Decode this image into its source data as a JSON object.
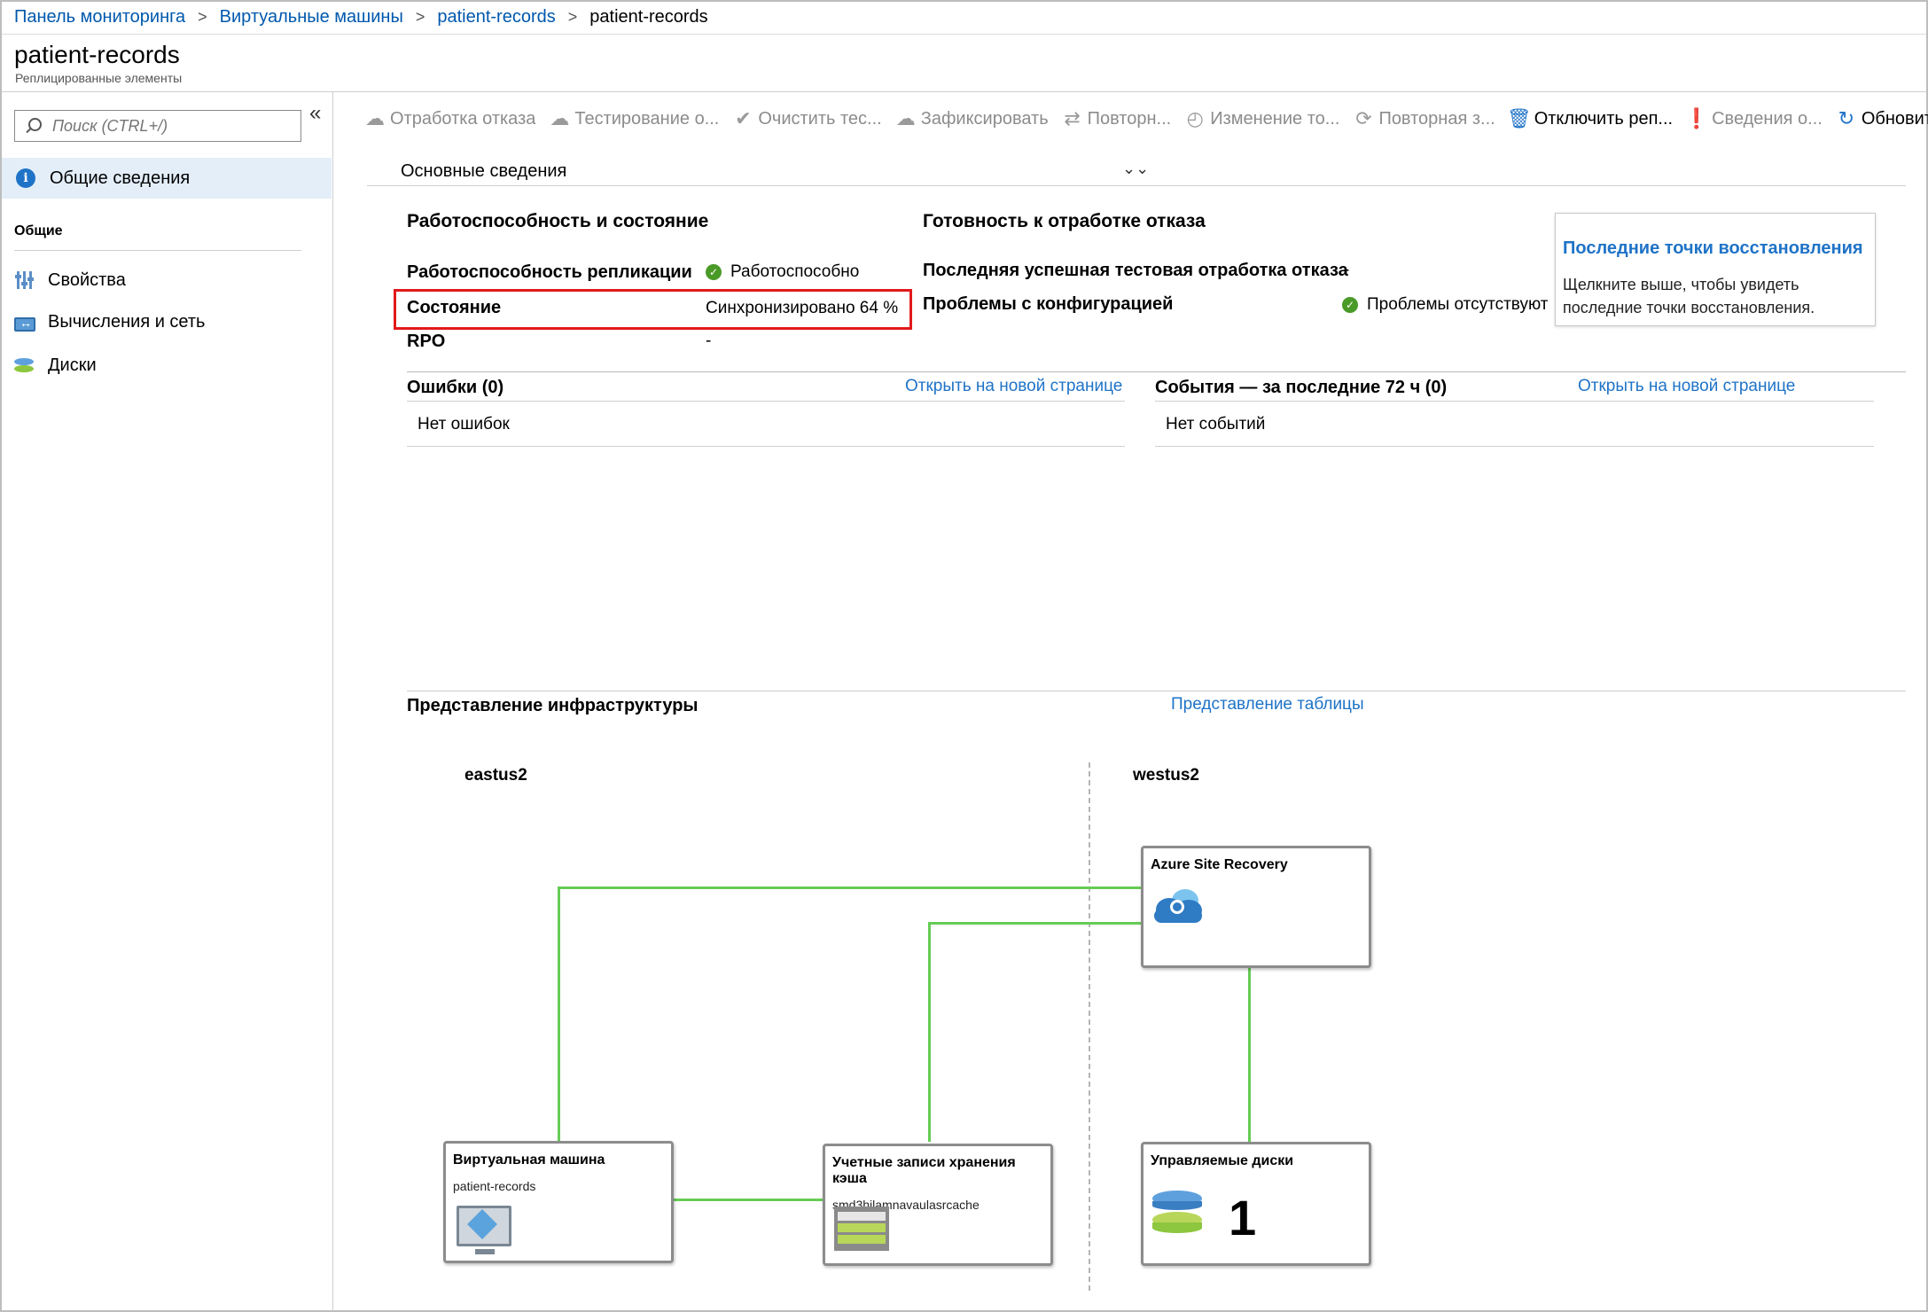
{
  "breadcrumb": {
    "items": [
      "Панель мониторинга",
      "Виртуальные машины",
      "patient-records"
    ],
    "current": "patient-records",
    "separator": ">"
  },
  "header": {
    "title": "patient-records",
    "subtitle": "Реплицированные элементы"
  },
  "sidebar": {
    "search_placeholder": "Поиск (CTRL+/)",
    "collapse_icon": "«",
    "overview_label": "Общие сведения",
    "section_label": "Общие",
    "items": [
      {
        "label": "Свойства",
        "icon": "properties-icon"
      },
      {
        "label": "Вычисления и сеть",
        "icon": "network-icon"
      },
      {
        "label": "Диски",
        "icon": "disks-icon"
      }
    ]
  },
  "toolbar": {
    "failover": "Отработка отказа",
    "test_failover": "Тестирование о...",
    "cleanup_test": "Очистить тес...",
    "commit": "Зафиксировать",
    "resync": "Повторн...",
    "change_recovery_point": "Изменение то...",
    "reprotect": "Повторная з...",
    "disable_replication": "Отключить реп...",
    "error_details": "Сведения о...",
    "refresh": "Обновить"
  },
  "essentials": {
    "label": "Основные сведения",
    "chevron": "⌄⌄"
  },
  "health": {
    "heading": "Работоспособность и состояние",
    "replication_health_label": "Работоспособность репликации",
    "replication_health_value": "Работоспособно",
    "status_label": "Состояние",
    "status_value": "Синхронизировано 64 %",
    "rpo_label": "RPO",
    "rpo_value": "-"
  },
  "failover_readiness": {
    "heading": "Готовность к отработке отказа",
    "last_test_label": "Последняя успешная тестовая отработка отказа",
    "last_test_value": "-",
    "config_issues_label": "Проблемы с конфигурацией",
    "config_issues_value": "Проблемы отсутствуют"
  },
  "recovery_points": {
    "link": "Последние точки восстановления",
    "text": "Щелкните выше, чтобы увидеть последние точки восстановления."
  },
  "errors": {
    "heading": "Ошибки (0)",
    "open_link": "Открыть на новой странице",
    "empty": "Нет ошибок"
  },
  "events": {
    "heading": "События — за последние 72 ч (0)",
    "open_link": "Открыть на новой странице",
    "empty": "Нет событий"
  },
  "infrastructure": {
    "heading": "Представление инфраструктуры",
    "table_view_link": "Представление таблицы",
    "source_region": "eastus2",
    "target_region": "westus2",
    "vm_node": {
      "title": "Виртуальная машина",
      "subtitle": "patient-records"
    },
    "cache_node": {
      "title": "Учетные записи хранения кэша",
      "subtitle": "smd3hjlamnavaulasrcache"
    },
    "asr_node": {
      "title": "Azure Site Recovery"
    },
    "disks_node": {
      "title": "Управляемые диски",
      "count": "1"
    }
  },
  "colors": {
    "link": "#0058ad",
    "accent": "#1f73c7",
    "highlight": "#e2191b",
    "connector": "#66cc55",
    "ok": "#4a9a28",
    "selected_bg": "#e3eef9"
  }
}
